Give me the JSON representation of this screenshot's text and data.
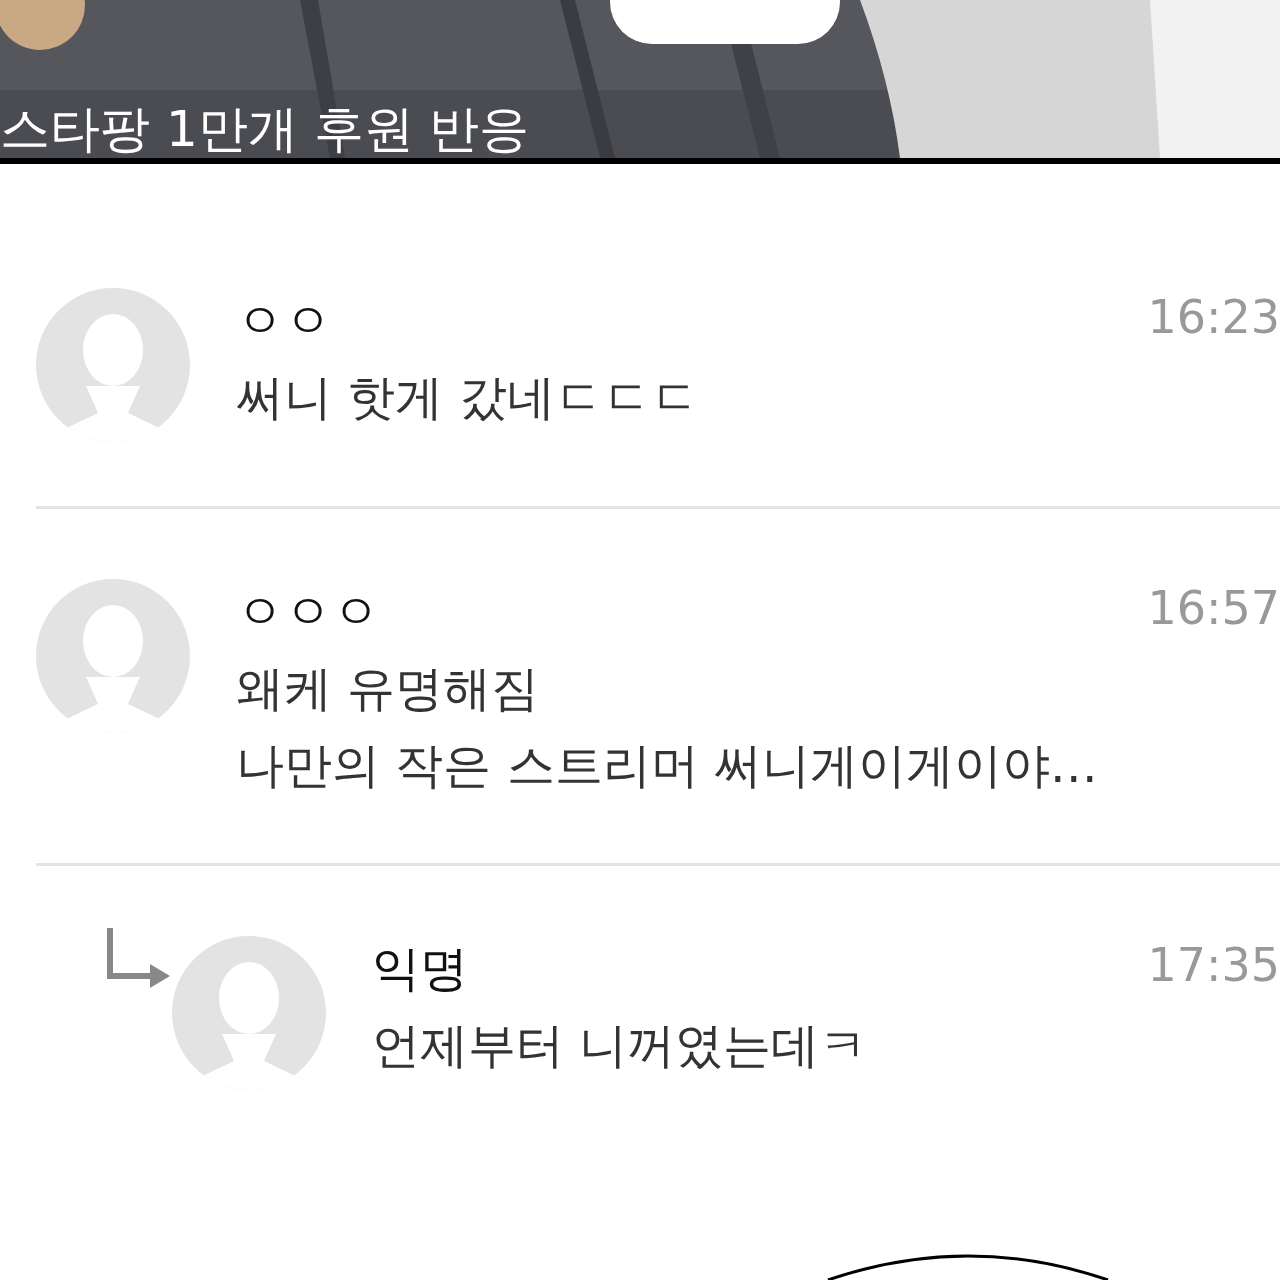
{
  "video": {
    "kind": "picture",
    "title": "스타팡 1만개 후원 반응"
  },
  "comments": [
    {
      "name": "ㅇㅇ",
      "time": "16:23",
      "text": [
        "써니 핫게 갔네ㄷㄷㄷ"
      ]
    },
    {
      "name": "ㅇㅇㅇ",
      "time": "16:57",
      "text": [
        "왜케 유명해짐",
        "나만의 작은 스트리머 써니게이게이야…"
      ],
      "children": [
        {
          "name": "익명",
          "time": "17:35",
          "text": [
            "언제부터 니꺼였는데ㅋ"
          ]
        }
      ]
    }
  ]
}
